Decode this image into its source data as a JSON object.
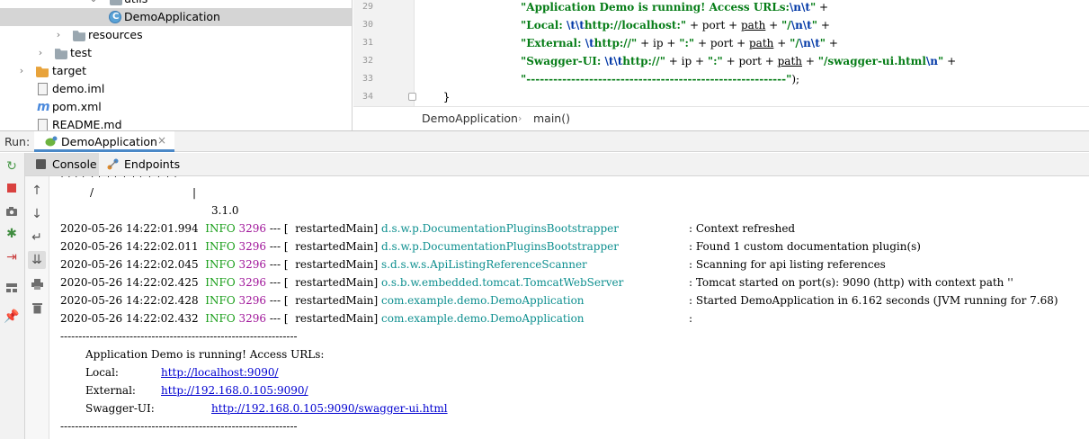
{
  "project_tree": {
    "items": [
      {
        "label": "utils",
        "icon": "folder-icon"
      },
      {
        "label": "DemoApplication",
        "icon": "java-class-icon"
      },
      {
        "label": "resources",
        "icon": "resources-folder-icon"
      },
      {
        "label": "test",
        "icon": "folder-icon"
      },
      {
        "label": "target",
        "icon": "excluded-folder-icon"
      },
      {
        "label": "demo.iml",
        "icon": "iml-file-icon"
      },
      {
        "label": "pom.xml",
        "icon": "maven-icon"
      },
      {
        "label": "README.md",
        "icon": "markdown-file-icon"
      }
    ]
  },
  "editor": {
    "line_numbers": [
      "29",
      "30",
      "31",
      "32",
      "33",
      "34"
    ],
    "lines": [
      {
        "s1": "\"Application Demo is running! Access URLs:",
        "e1": "\\n\\t",
        "s2": "\"",
        "rest": " +"
      },
      {
        "s1": "\"Local: ",
        "e1": "\\t\\t",
        "s2": "http://localhost:\"",
        "mid": " + port + ",
        "u": "path",
        "mid2": " + ",
        "s3": "\"/",
        "e2": "\\n\\t",
        "s4": "\"",
        "rest": " +"
      },
      {
        "s1": "\"External: ",
        "e1": "\\t",
        "s2": "http://\"",
        "mid": " + ip + ",
        "s3": "\":\"",
        "mid2": " + port + ",
        "u": "path",
        "mid3": " + ",
        "s4": "\"/",
        "e2": "\\n\\t",
        "s5": "\"",
        "rest": " +"
      },
      {
        "s1": "\"Swagger-UI: ",
        "e1": "\\t\\t",
        "s2": "http://\"",
        "mid": " + ip + ",
        "s3": "\":\"",
        "mid2": " + port + ",
        "u": "path",
        "mid3": " + ",
        "s4": "\"/swagger-ui.html",
        "e2": "\\n",
        "s5": "\"",
        "rest": " +"
      },
      {
        "s1": "\"----------------------------------------------------------\"",
        "rest": ");"
      }
    ],
    "closing_brace": "}",
    "breadcrumb": [
      "DemoApplication",
      "main()"
    ]
  },
  "run_window": {
    "label": "Run:",
    "tab_label": "DemoApplication",
    "tab_close": "×",
    "subtabs": [
      "Console",
      "Endpoints"
    ]
  },
  "console": {
    "banner": [
      "/",
      "|",
      "3.1.0"
    ],
    "log_lines": [
      {
        "ts": "2020-05-26 14:22:01.994",
        "level": "INFO",
        "pid": "3296",
        "sep": "--- [",
        "thread": "restartedMain]",
        "logger": "d.s.w.p.DocumentationPluginsBootstrapper",
        "msg": ": Context refreshed"
      },
      {
        "ts": "2020-05-26 14:22:02.011",
        "level": "INFO",
        "pid": "3296",
        "sep": "--- [",
        "thread": "restartedMain]",
        "logger": "d.s.w.p.DocumentationPluginsBootstrapper",
        "msg": ": Found 1 custom documentation plugin(s)"
      },
      {
        "ts": "2020-05-26 14:22:02.045",
        "level": "INFO",
        "pid": "3296",
        "sep": "--- [",
        "thread": "restartedMain]",
        "logger": "s.d.s.w.s.ApiListingReferenceScanner",
        "msg": ": Scanning for api listing references"
      },
      {
        "ts": "2020-05-26 14:22:02.425",
        "level": "INFO",
        "pid": "3296",
        "sep": "--- [",
        "thread": "restartedMain]",
        "logger": "o.s.b.w.embedded.tomcat.TomcatWebServer",
        "msg": ": Tomcat started on port(s): 9090 (http) with context path ''"
      },
      {
        "ts": "2020-05-26 14:22:02.428",
        "level": "INFO",
        "pid": "3296",
        "sep": "--- [",
        "thread": "restartedMain]",
        "logger": "com.example.demo.DemoApplication",
        "msg": ": Started DemoApplication in 6.162 seconds (JVM running for 7.68)"
      },
      {
        "ts": "2020-05-26 14:22:02.432",
        "level": "INFO",
        "pid": "3296",
        "sep": "--- [",
        "thread": "restartedMain]",
        "logger": "com.example.demo.DemoApplication",
        "msg": ":"
      }
    ],
    "divider": "-----------------------------------------------------------------",
    "access_title": "Application Demo is running! Access URLs:",
    "urls": [
      {
        "label": "Local:",
        "url": "http://localhost:9090/"
      },
      {
        "label": "External:",
        "url": "http://192.168.0.105:9090/"
      },
      {
        "label": "Swagger-UI:",
        "url": "http://192.168.0.105:9090/swagger-ui.html"
      }
    ]
  },
  "colors": {
    "string": "#067d17",
    "escape": "#0037a6",
    "log_level": "#1a9e1a",
    "pid": "#a0169a",
    "logger": "#0d8f8f",
    "link": "#0000d0",
    "tab_underline": "#4a88c7"
  }
}
